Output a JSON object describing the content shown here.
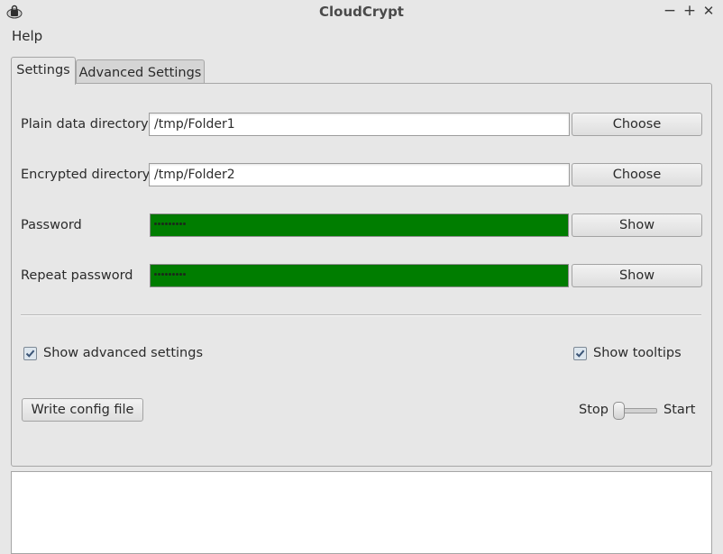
{
  "window": {
    "title": "CloudCrypt",
    "controls": {
      "minimize": "−",
      "maximize": "+",
      "close": "✕"
    }
  },
  "menu": {
    "items": [
      "Help"
    ]
  },
  "tabs": [
    {
      "label": "Settings",
      "active": true
    },
    {
      "label": "Advanced Settings",
      "active": false
    }
  ],
  "settings": {
    "plain": {
      "label": "Plain data directory",
      "value": "/tmp/Folder1",
      "button": "Choose"
    },
    "encrypted": {
      "label": "Encrypted directory",
      "value": "/tmp/Folder2",
      "button": "Choose"
    },
    "password": {
      "label": "Password",
      "masked_length": 9,
      "button": "Show"
    },
    "repeat": {
      "label": "Repeat password",
      "masked_length": 9,
      "button": "Show"
    },
    "show_advanced": {
      "label": "Show advanced settings",
      "checked": true
    },
    "show_tooltips": {
      "label": "Show tooltips",
      "checked": true
    },
    "write_config": "Write config file",
    "slider": {
      "left_label": "Stop",
      "right_label": "Start",
      "value": 0
    }
  },
  "colors": {
    "password_match_bg": "#007d00",
    "window_bg": "#e7e7e7"
  },
  "log": {
    "text": ""
  }
}
